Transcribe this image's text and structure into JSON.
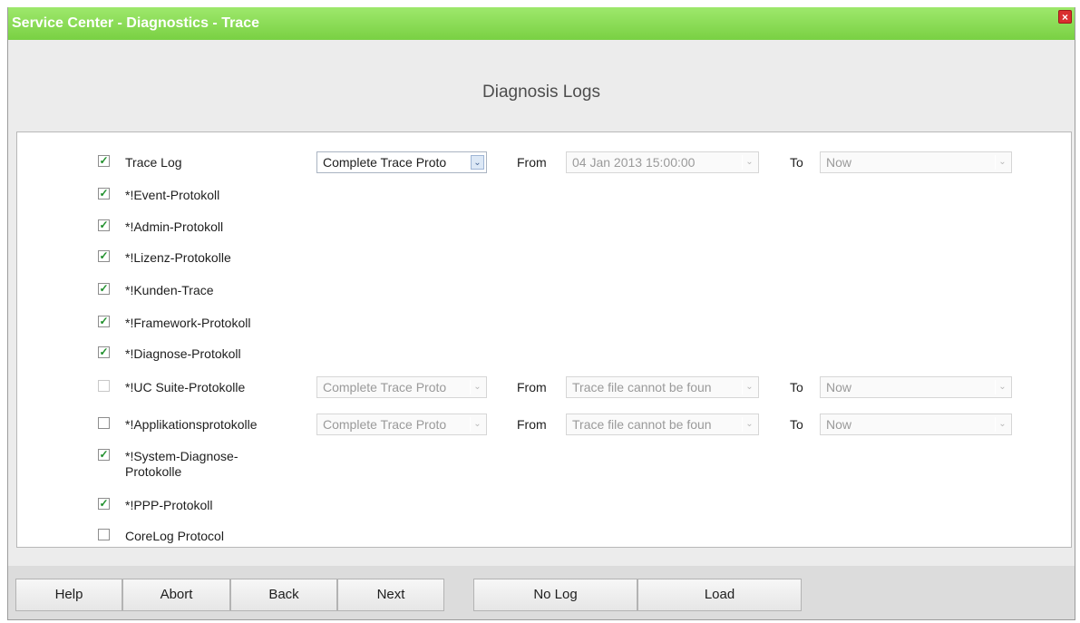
{
  "window": {
    "title": "Service Center - Diagnostics - Trace",
    "close_label": "×"
  },
  "heading": "Diagnosis Logs",
  "rows": [
    {
      "label": "Trace Log",
      "checked": true,
      "enabled": true,
      "select": "Complete Trace Proto",
      "from_label": "From",
      "from_value": "04 Jan 2013 15:00:00",
      "to_label": "To",
      "to_value": "Now"
    },
    {
      "label": "*!Event-Protokoll",
      "checked": true,
      "enabled": true
    },
    {
      "label": "*!Admin-Protokoll",
      "checked": true,
      "enabled": true
    },
    {
      "label": "*!Lizenz-Protokolle",
      "checked": true,
      "enabled": true
    },
    {
      "label": "*!Kunden-Trace",
      "checked": true,
      "enabled": true
    },
    {
      "label": "*!Framework-Protokoll",
      "checked": true,
      "enabled": true
    },
    {
      "label": "*!Diagnose-Protokoll",
      "checked": true,
      "enabled": true
    },
    {
      "label": "*!UC Suite-Protokolle",
      "checked": false,
      "enabled": false,
      "select": "Complete Trace Proto",
      "from_label": "From",
      "from_value": "Trace file cannot be foun",
      "to_label": "To",
      "to_value": "Now"
    },
    {
      "label": "*!Applikationsprotokolle",
      "checked": false,
      "enabled": true,
      "select": "Complete Trace Proto",
      "from_label": "From",
      "from_value": "Trace file cannot be foun",
      "to_label": "To",
      "to_value": "Now"
    },
    {
      "label_line1": "*!System-Diagnose-",
      "label_line2": "Protokolle",
      "checked": true,
      "enabled": true
    },
    {
      "label": "*!PPP-Protokoll",
      "checked": true,
      "enabled": true
    },
    {
      "label": "CoreLog Protocol",
      "checked": false,
      "enabled": true
    }
  ],
  "footer": {
    "help": "Help",
    "abort": "Abort",
    "back": "Back",
    "next": "Next",
    "no_log": "No Log",
    "load": "Load"
  },
  "icons": {
    "checkmark": "✓",
    "dropdown": "⌄"
  },
  "colors": {
    "title_bar": "#79d043",
    "close_button": "#d92f2f",
    "checkmark": "#1f8f2b"
  }
}
